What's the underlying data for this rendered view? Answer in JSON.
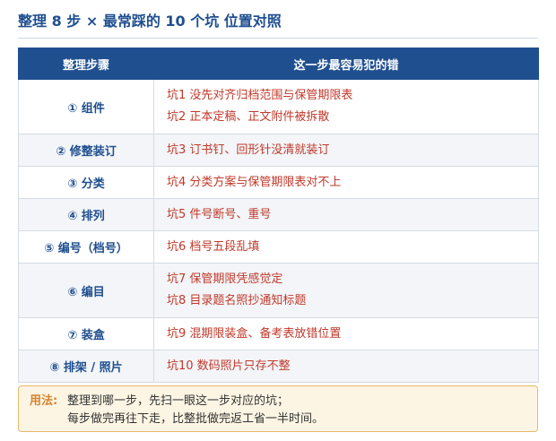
{
  "title": "整理 8 步 × 最常踩的 10 个坑 位置对照",
  "table": {
    "headers": [
      "整理步骤",
      "这一步最容易犯的错"
    ],
    "rows": [
      {
        "step": "① 组件",
        "pits": [
          "坑1 没先对齐归档范围与保管期限表",
          "坑2 正本定稿、正文附件被拆散"
        ]
      },
      {
        "step": "② 修整装订",
        "pits": [
          "坑3 订书钉、回形针没清就装订"
        ]
      },
      {
        "step": "③ 分类",
        "pits": [
          "坑4 分类方案与保管期限表对不上"
        ]
      },
      {
        "step": "④ 排列",
        "pits": [
          "坑5 件号断号、重号"
        ]
      },
      {
        "step": "⑤ 编号（档号）",
        "pits": [
          "坑6 档号五段乱填"
        ]
      },
      {
        "step": "⑥ 编目",
        "pits": [
          "坑7 保管期限凭感觉定",
          "坑8 目录题名照抄通知标题"
        ]
      },
      {
        "step": "⑦ 装盒",
        "pits": [
          "坑9 混期限装盒、备考表放错位置"
        ]
      },
      {
        "step": "⑧ 排架 / 照片",
        "pits": [
          "坑10 数码照片只存不整"
        ]
      }
    ]
  },
  "usage": {
    "label": "用法:",
    "lines": [
      "整理到哪一步，先扫一眼这一步对应的坑；",
      "每步做完再往下走，比整批做完返工省一半时间。"
    ]
  },
  "colors": {
    "header_bg": "#1f4f8f",
    "step_text": "#1f4f8f",
    "pit_text": "#c0392b",
    "usage_bg": "#fdf5e4",
    "usage_border": "#e8b86b",
    "usage_label": "#d9822b"
  }
}
